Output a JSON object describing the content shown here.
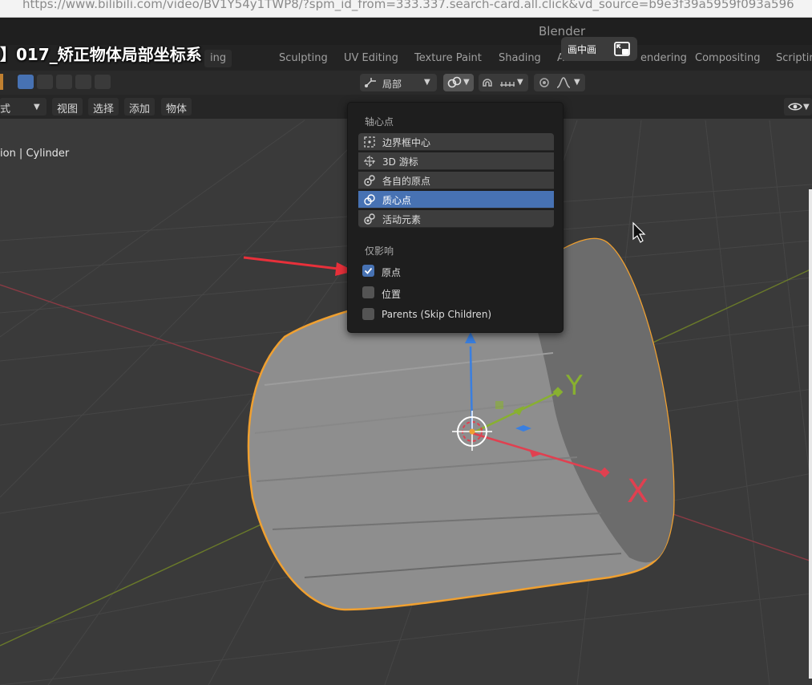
{
  "browser": {
    "url": "https://www.bilibili.com/video/BV1Y54y1TWP8/?spm_id_from=333.337.search-card.all.click&vd_source=b9e3f39a5959f093a596"
  },
  "app": {
    "title": "Blender"
  },
  "video": {
    "title": "】017_矫正物体局部坐标系"
  },
  "pip": {
    "label": "画中画"
  },
  "tabs": [
    "ing",
    "Sculpting",
    "UV Editing",
    "Texture Paint",
    "Shading",
    "A",
    "endering",
    "Compositing",
    "Scriptin"
  ],
  "header": {
    "transform_orientation": "局部"
  },
  "menus": {
    "mode": "式",
    "items": [
      "视图",
      "选择",
      "添加",
      "物体"
    ]
  },
  "viewport": {
    "object_label": "ion | Cylinder",
    "axis_y": "Y",
    "axis_x": "X"
  },
  "pivot_menu": {
    "heading": "轴心点",
    "options": [
      {
        "label": "边界框中心",
        "icon": "bounding-box-center-icon",
        "selected": false
      },
      {
        "label": "3D 游标",
        "icon": "3d-cursor-icon",
        "selected": false
      },
      {
        "label": "各自的原点",
        "icon": "individual-origins-icon",
        "selected": false
      },
      {
        "label": "质心点",
        "icon": "median-point-icon",
        "selected": true
      },
      {
        "label": "活动元素",
        "icon": "active-element-icon",
        "selected": false
      }
    ],
    "affect_heading": "仅影响",
    "affect_only": [
      {
        "label": "原点",
        "checked": true
      },
      {
        "label": "位置",
        "checked": false
      },
      {
        "label": "Parents (Skip Children)",
        "checked": false
      }
    ]
  },
  "colors": {
    "accent": "#4772b3",
    "annotation_arrow": "#e8303a",
    "outline": "#f0a030",
    "axis_x": "#e04050",
    "axis_y": "#88b030",
    "axis_z": "#3a7fe0"
  }
}
